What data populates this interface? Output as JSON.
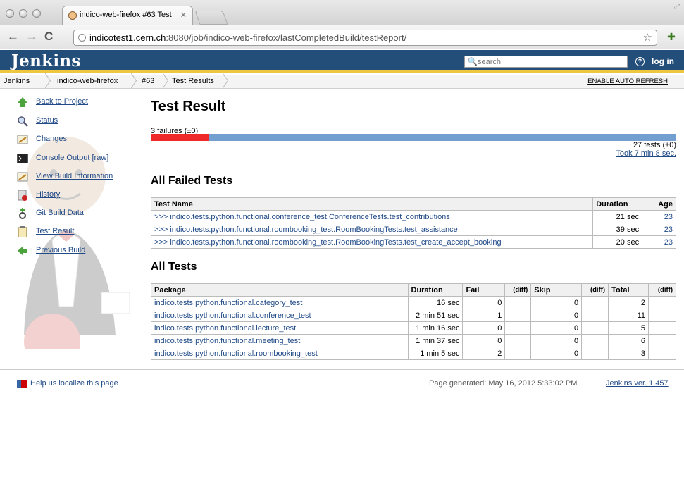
{
  "browser": {
    "tab_title": "indico-web-firefox #63 Test",
    "url_host": "indicotest1.cern.ch",
    "url_rest": ":8080/job/indico-web-firefox/lastCompletedBuild/testReport/"
  },
  "header": {
    "logo": "Jenkins",
    "search_placeholder": "search",
    "login_label": "log in",
    "help_icon": "?"
  },
  "breadcrumb": {
    "items": [
      "Jenkins",
      "indico-web-firefox",
      "#63",
      "Test Results"
    ],
    "auto_refresh": "ENABLE AUTO REFRESH"
  },
  "sidebar": {
    "items": [
      {
        "label": "Back to Project",
        "icon": "up-arrow-icon"
      },
      {
        "label": "Status",
        "icon": "magnifier-icon"
      },
      {
        "label": "Changes",
        "icon": "notepad-icon"
      },
      {
        "label": "Console Output",
        "extra": "[raw]",
        "icon": "terminal-icon"
      },
      {
        "label": "View Build Information",
        "icon": "notepad-icon"
      },
      {
        "label": "History",
        "icon": "history-icon"
      },
      {
        "label": "Git Build Data",
        "icon": "git-icon"
      },
      {
        "label": "Test Result",
        "icon": "clipboard-icon"
      },
      {
        "label": "Previous Build",
        "icon": "left-arrow-icon"
      }
    ]
  },
  "main": {
    "title": "Test Result",
    "failures_label": "3 failures (±0)",
    "failure_fraction": 0.111,
    "tests_total": "27 tests (±0)",
    "took": "Took 7 min 8 sec."
  },
  "failed": {
    "heading": "All Failed Tests",
    "columns": [
      "Test Name",
      "Duration",
      "Age"
    ],
    "rows": [
      {
        "link": ">>>",
        "name": "indico.tests.python.functional.conference_test.ConferenceTests.test_contributions",
        "duration": "21 sec",
        "age": "23"
      },
      {
        "link": ">>>",
        "name": "indico.tests.python.functional.roombooking_test.RoomBookingTests.test_assistance",
        "duration": "39 sec",
        "age": "23"
      },
      {
        "link": ">>>",
        "name": "indico.tests.python.functional.roombooking_test.RoomBookingTests.test_create_accept_booking",
        "duration": "20 sec",
        "age": "23"
      }
    ]
  },
  "all": {
    "heading": "All Tests",
    "columns": [
      "Package",
      "Duration",
      "Fail",
      "(diff)",
      "Skip",
      "(diff)",
      "Total",
      "(diff)"
    ],
    "rows": [
      {
        "package": "indico.tests.python.functional.category_test",
        "duration": "16 sec",
        "fail": "0",
        "fail_diff": "",
        "skip": "0",
        "skip_diff": "",
        "total": "2",
        "total_diff": ""
      },
      {
        "package": "indico.tests.python.functional.conference_test",
        "duration": "2 min 51 sec",
        "fail": "1",
        "fail_diff": "",
        "skip": "0",
        "skip_diff": "",
        "total": "11",
        "total_diff": ""
      },
      {
        "package": "indico.tests.python.functional.lecture_test",
        "duration": "1 min 16 sec",
        "fail": "0",
        "fail_diff": "",
        "skip": "0",
        "skip_diff": "",
        "total": "5",
        "total_diff": ""
      },
      {
        "package": "indico.tests.python.functional.meeting_test",
        "duration": "1 min 37 sec",
        "fail": "0",
        "fail_diff": "",
        "skip": "0",
        "skip_diff": "",
        "total": "6",
        "total_diff": ""
      },
      {
        "package": "indico.tests.python.functional.roombooking_test",
        "duration": "1 min 5 sec",
        "fail": "2",
        "fail_diff": "",
        "skip": "0",
        "skip_diff": "",
        "total": "3",
        "total_diff": ""
      }
    ]
  },
  "footer": {
    "localize": "Help us localize this page",
    "generated": "Page generated: May 16, 2012 5:33:02 PM",
    "version": "Jenkins ver. 1.457"
  },
  "colors": {
    "header_bg": "#244e7a",
    "accent_bar": "#eec73f",
    "fail_red": "#ef2929",
    "pass_blue": "#729fcf"
  }
}
